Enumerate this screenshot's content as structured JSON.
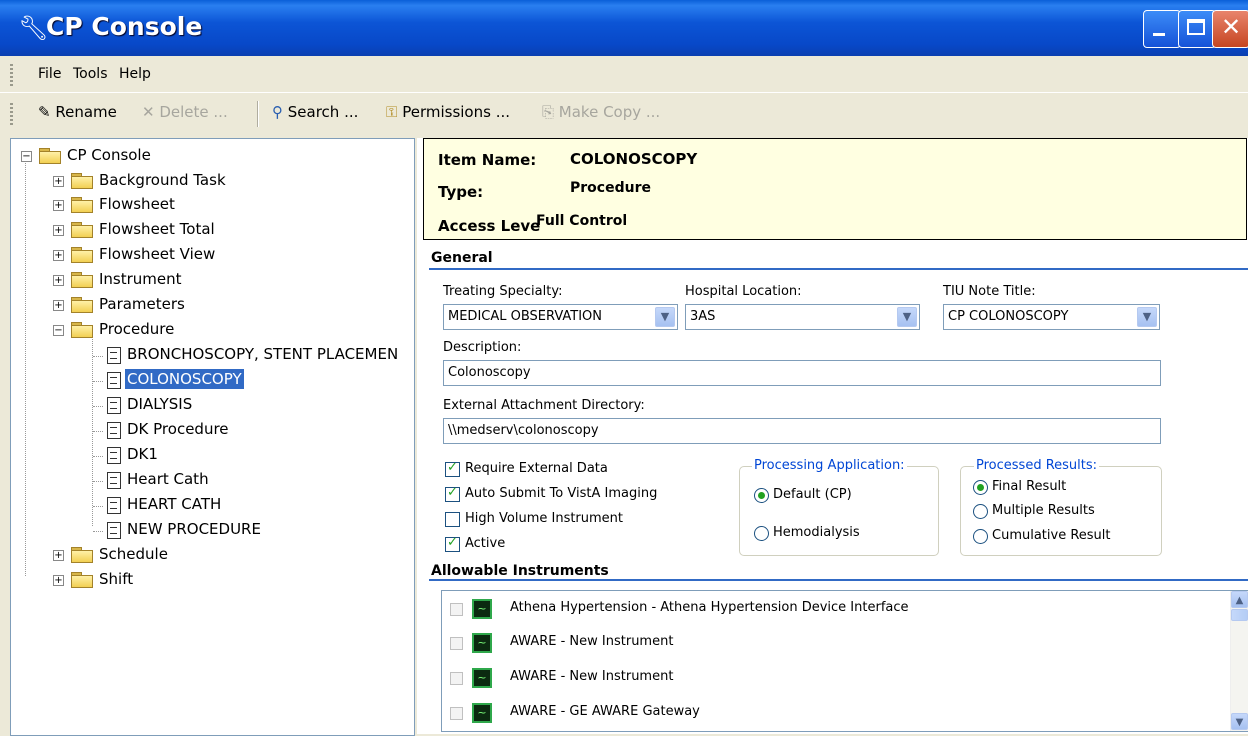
{
  "window": {
    "title": "CP Console",
    "icon": "wrench-icon"
  },
  "menu": [
    "File",
    "Tools",
    "Help"
  ],
  "toolbar": {
    "rename": "Rename",
    "delete": "Delete ...",
    "search": "Search ...",
    "permissions": "Permissions ...",
    "make_copy": "Make Copy ..."
  },
  "tree": {
    "root": "CP Console",
    "folders": [
      "Background Task",
      "Flowsheet",
      "Flowsheet Total",
      "Flowsheet View",
      "Instrument",
      "Parameters",
      "Procedure"
    ],
    "procedure_items": [
      "BRONCHOSCOPY, STENT PLACEMEN",
      "COLONOSCOPY",
      "DIALYSIS",
      "DK Procedure",
      "DK1",
      "Heart Cath",
      "HEART CATH",
      "NEW PROCEDURE"
    ],
    "selected": "COLONOSCOPY",
    "after_folders": [
      "Schedule",
      "Shift"
    ]
  },
  "info": {
    "item_name_label": "Item Name:",
    "item_name": "COLONOSCOPY",
    "type_label": "Type:",
    "type": "Procedure",
    "access_label": "Access Leve",
    "access": "Full Control"
  },
  "general": {
    "heading": "General",
    "treating_label": "Treating Specialty:",
    "treating_value": "MEDICAL OBSERVATION",
    "location_label": "Hospital Location:",
    "location_value": "3AS",
    "tiu_label": "TIU Note Title:",
    "tiu_value": "CP COLONOSCOPY",
    "description_label": "Description:",
    "description_value": "Colonoscopy",
    "ext_dir_label": "External Attachment Directory:",
    "ext_dir_value": "\\\\medserv\\colonoscopy",
    "checkboxes": [
      {
        "label": "Require External Data",
        "checked": true
      },
      {
        "label": "Auto Submit To VistA Imaging",
        "checked": true
      },
      {
        "label": "High Volume Instrument",
        "checked": false
      },
      {
        "label": "Active",
        "checked": true
      }
    ],
    "processing_app": {
      "legend": "Processing Application:",
      "options": [
        "Default (CP)",
        "Hemodialysis"
      ],
      "selected": "Default (CP)"
    },
    "processed_results": {
      "legend": "Processed Results:",
      "options": [
        "Final Result",
        "Multiple Results",
        "Cumulative Result"
      ],
      "selected": "Final Result"
    }
  },
  "instruments": {
    "heading": "Allowable Instruments",
    "items": [
      "Athena Hypertension - Athena Hypertension Device Interface",
      "AWARE - New Instrument",
      "AWARE - New Instrument",
      "AWARE - GE AWARE Gateway"
    ]
  }
}
